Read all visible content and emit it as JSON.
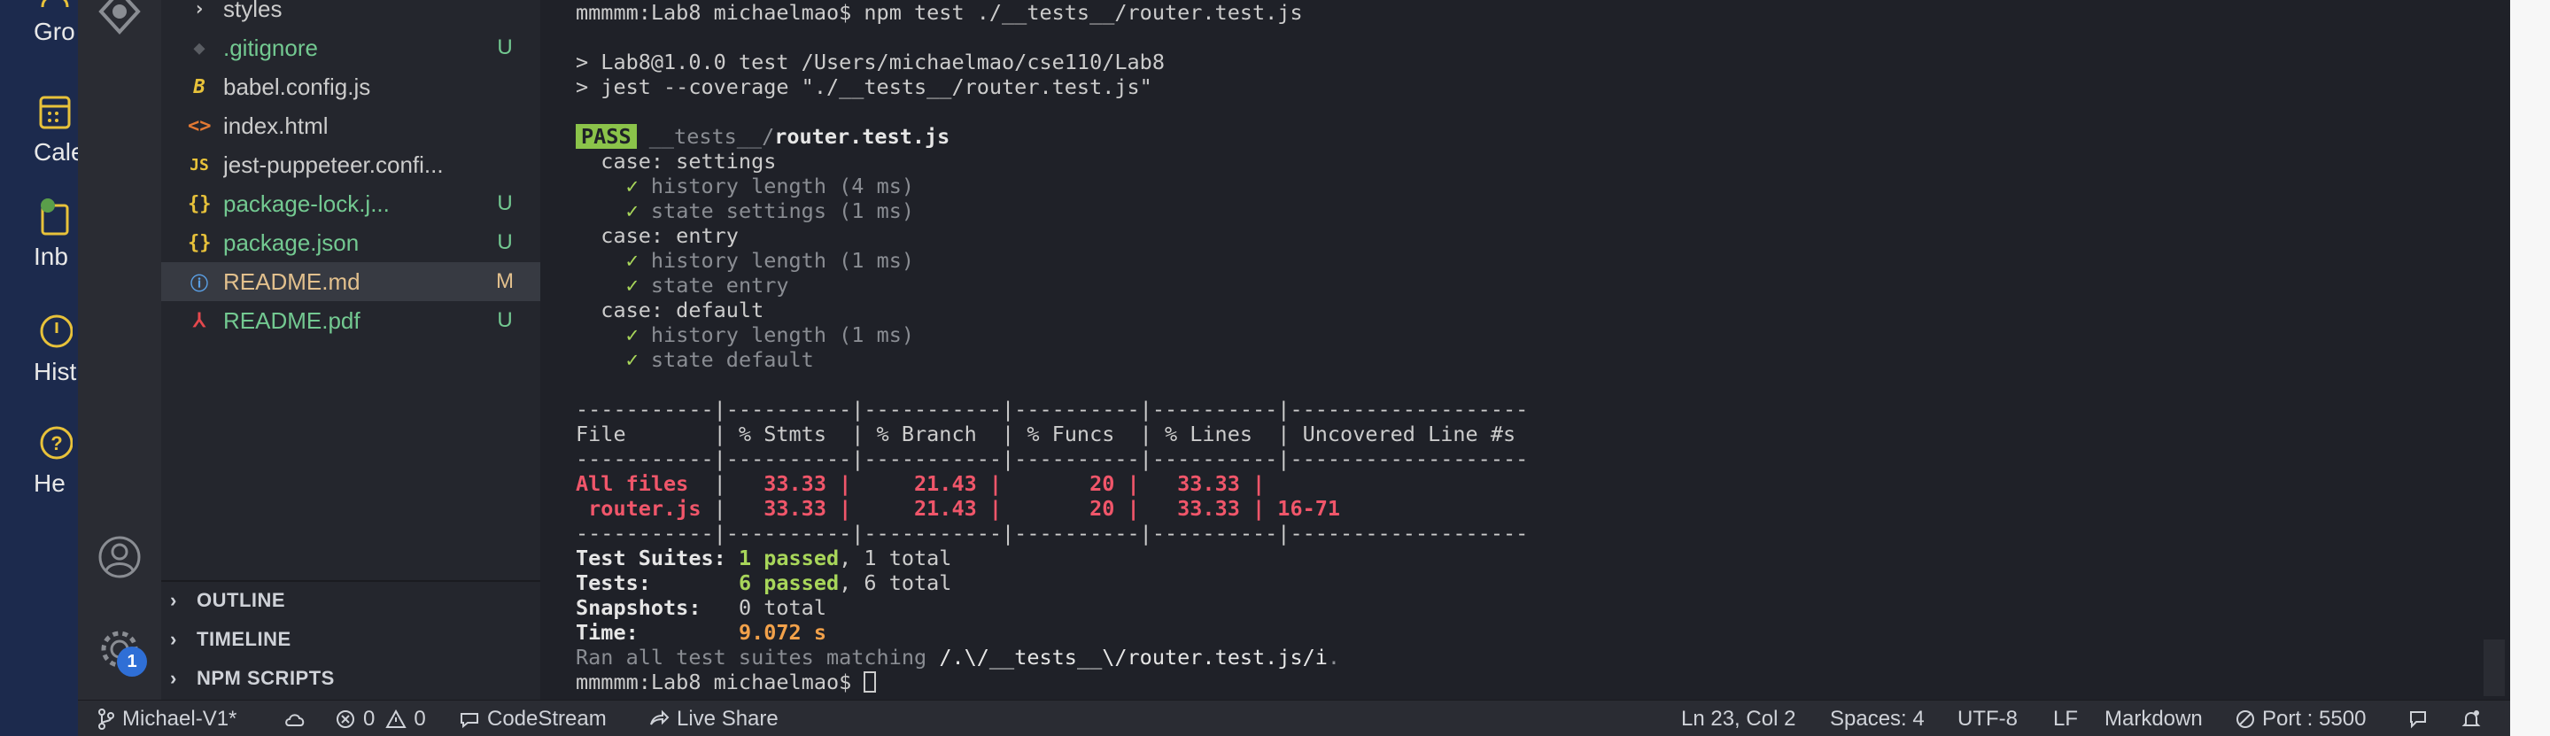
{
  "desktop": {
    "items": [
      {
        "label": "Gro",
        "icon": "people-icon"
      },
      {
        "label": "Cale",
        "icon": "calendar-icon"
      },
      {
        "label": "Inb",
        "icon": "inbox-icon"
      },
      {
        "label": "Hist",
        "icon": "history-icon"
      },
      {
        "label": "He",
        "icon": "help-icon"
      }
    ]
  },
  "explorer": {
    "files": [
      {
        "name": "styles",
        "status": "",
        "icon": "folder-chevron",
        "color": "#cccccc"
      },
      {
        "name": ".gitignore",
        "status": "U",
        "icon": "git-icon",
        "color": "#73c991"
      },
      {
        "name": "babel.config.js",
        "status": "",
        "icon": "babel-icon",
        "color": "#cccccc"
      },
      {
        "name": "index.html",
        "status": "",
        "icon": "html-icon",
        "color": "#cccccc"
      },
      {
        "name": "jest-puppeteer.confi...",
        "status": "",
        "icon": "js-icon",
        "color": "#cccccc"
      },
      {
        "name": "package-lock.j...",
        "status": "U",
        "icon": "json-icon",
        "color": "#73c991"
      },
      {
        "name": "package.json",
        "status": "U",
        "icon": "json-icon",
        "color": "#73c991"
      },
      {
        "name": "README.md",
        "status": "M",
        "icon": "info-icon",
        "color": "#e2c08d"
      },
      {
        "name": "README.pdf",
        "status": "U",
        "icon": "pdf-icon",
        "color": "#73c991"
      }
    ],
    "sections": [
      "OUTLINE",
      "TIMELINE",
      "NPM SCRIPTS"
    ]
  },
  "terminal": {
    "prompt1": "mmmmm:Lab8 michaelmao$ npm test ./__tests__/router.test.js",
    "npm_line1": "> Lab8@1.0.0 test /Users/michaelmao/cse110/Lab8",
    "npm_line2": "> jest --coverage \"./__tests__/router.test.js\"",
    "pass_label": "PASS",
    "test_path_dim": "__tests__/",
    "test_path_bold": "router.test.js",
    "cases": [
      {
        "title": "  case: settings",
        "checks": [
          "history length (4 ms)",
          "state settings (1 ms)"
        ]
      },
      {
        "title": "  case: entry",
        "checks": [
          "history length (1 ms)",
          "state entry"
        ]
      },
      {
        "title": "  case: default",
        "checks": [
          "history length (1 ms)",
          "state default"
        ]
      }
    ],
    "check_mark": "✓",
    "table_rule": "-----------|----------|-----------|----------|----------|-------------------",
    "table_header": "File       | % Stmts  | % Branch  | % Funcs  | % Lines  | Uncovered Line #s ",
    "row_all": "All files ",
    "row_all_sep": " | ",
    "row_all_values": "  33.33 |     21.43 |       20 |   33.33 | ",
    "row_router": " router.js ",
    "row_router_values": "  33.33 |     21.43 |       20 |   33.33 | 16-71",
    "summary": {
      "suites_label": "Test Suites: ",
      "suites_passed": "1 passed",
      "suites_total": ", 1 total",
      "tests_label": "Tests:       ",
      "tests_passed": "6 passed",
      "tests_total": ", 6 total",
      "snapshots_label": "Snapshots:   ",
      "snapshots_value": "0 total",
      "time_label": "Time:        ",
      "time_value": "9.072 s"
    },
    "ran_prefix": "Ran all test suites matching ",
    "ran_pattern": "/.\\/__tests__\\/router.test.js/i",
    "ran_suffix": ".",
    "prompt2": "mmmmm:Lab8 michaelmao$ "
  },
  "statusbar": {
    "branch": "Michael-V1*",
    "errors": "0",
    "warnings": "0",
    "codestream": "CodeStream",
    "liveshare": "Live Share",
    "position": "Ln 23, Col 2",
    "spaces": "Spaces: 4",
    "encoding": "UTF-8",
    "eol": "LF",
    "language": "Markdown",
    "port": "Port : 5500"
  },
  "activity": {
    "settings_badge": "1"
  }
}
